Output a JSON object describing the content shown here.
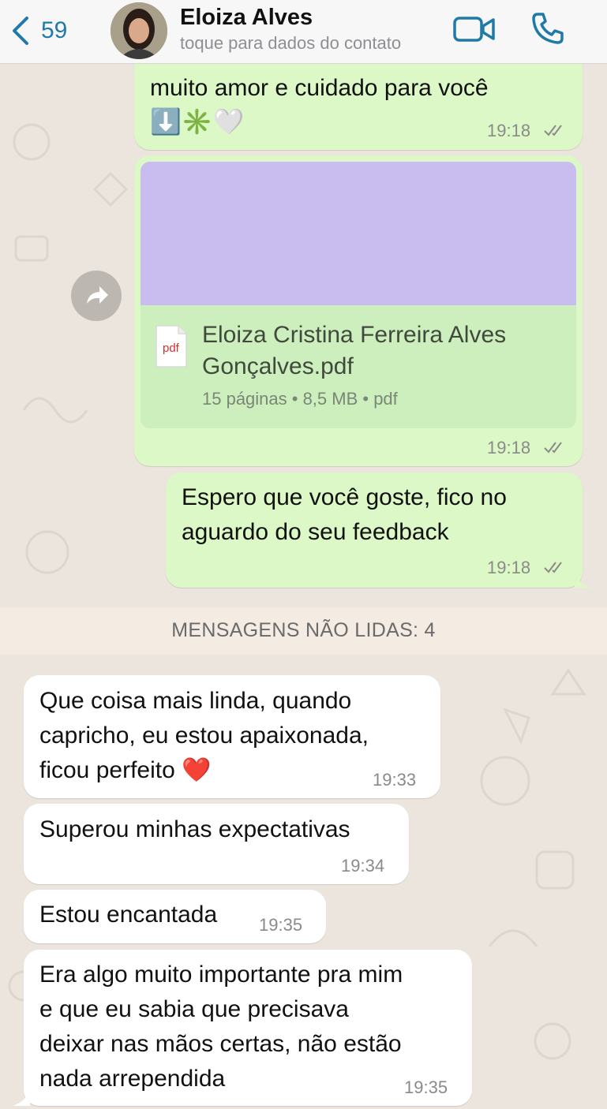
{
  "header": {
    "back_count": "59",
    "contact_name": "Eloiza Alves",
    "contact_subtitle": "toque para dados do contato",
    "icons": [
      "back-chevron-icon",
      "video-call-icon",
      "phone-icon"
    ]
  },
  "messages_out": [
    {
      "text": "muito amor e cuidado para você",
      "emoji": "⬇️✳️🤍",
      "time": "19:18",
      "status": "read-ticks"
    },
    {
      "document": {
        "name_line1": "Eloiza Cristina Ferreira Alves",
        "name_line2": "Gonçalves.pdf",
        "meta": "15 páginas • 8,5 MB • pdf",
        "icon_label": "pdf"
      },
      "time": "19:18",
      "status": "read-ticks"
    },
    {
      "text_line1": "Espero que você goste, fico no",
      "text_line2": "aguardo do seu feedback",
      "time": "19:18",
      "status": "read-ticks"
    }
  ],
  "unread_banner": "MENSAGENS NÃO LIDAS: 4",
  "messages_in": [
    {
      "line1": "Que coisa mais linda, quando",
      "line2": "capricho, eu estou apaixonada,",
      "line3": "ficou perfeito ❤️",
      "time": "19:33"
    },
    {
      "line1": "Superou minhas expectativas",
      "time": "19:34"
    },
    {
      "line1": "Estou encantada",
      "time": "19:35"
    },
    {
      "line1": "Era algo muito importante pra mim",
      "line2": "e que eu sabia que precisava",
      "line3": "deixar nas mãos certas, não estão",
      "line4": "nada arrependida",
      "time": "19:35"
    }
  ],
  "colors": {
    "accent": "#1f7aa8",
    "outgoing_bubble": "#dcf8c6",
    "incoming_bubble": "#ffffff",
    "chat_background": "#ece5dd"
  }
}
